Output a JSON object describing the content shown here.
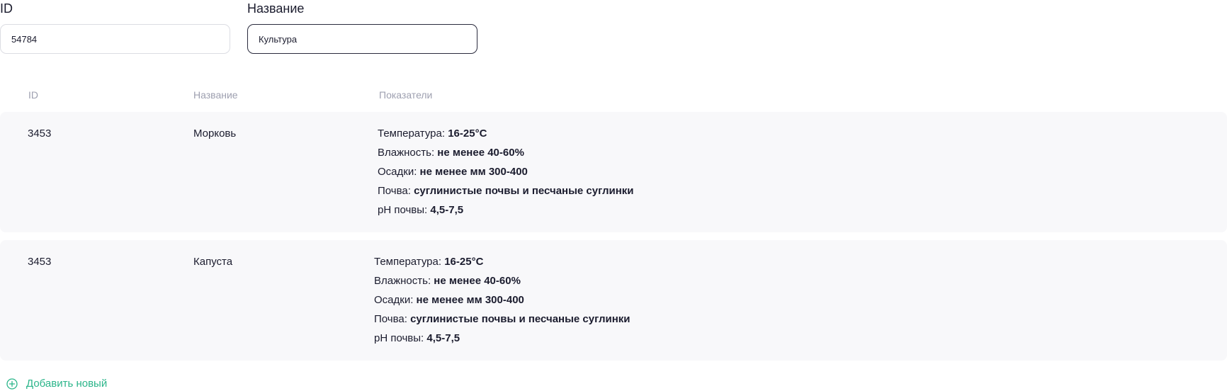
{
  "filters": {
    "id": {
      "label": "ID",
      "value": "54784"
    },
    "name": {
      "label": "Название",
      "value": "Культура"
    }
  },
  "table": {
    "columns": [
      "ID",
      "Название",
      "Показатели"
    ],
    "rows": [
      {
        "id": "3453",
        "name": "Морковь",
        "metrics": [
          {
            "label": "Температура:",
            "value": "16-25°C"
          },
          {
            "label": "Влажность:",
            "value": "не менее 40-60%"
          },
          {
            "label": "Осадки:",
            "value": "не менее мм 300-400"
          },
          {
            "label": "Почва:",
            "value": "суглинистые почвы и песчаные суглинки"
          },
          {
            "label": "pH почвы:",
            "value": "4,5-7,5"
          }
        ]
      },
      {
        "id": "3453",
        "name": "Капуста",
        "metrics": [
          {
            "label": "Температура:",
            "value": "16-25°C"
          },
          {
            "label": "Влажность:",
            "value": "не менее 40-60%"
          },
          {
            "label": "Осадки:",
            "value": "не менее мм 300-400"
          },
          {
            "label": "Почва:",
            "value": "суглинистые почвы и песчаные суглинки"
          },
          {
            "label": "pH почвы:",
            "value": "4,5-7,5"
          }
        ]
      }
    ]
  },
  "add_new": {
    "label": "Добавить новый",
    "icon": "plus-circle-icon",
    "color": "#2bb58a"
  }
}
